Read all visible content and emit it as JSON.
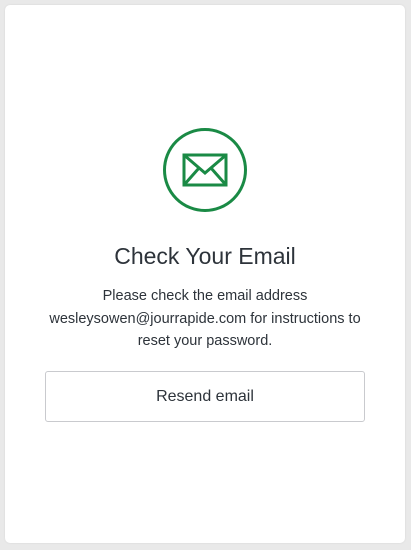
{
  "card": {
    "title": "Check Your Email",
    "message_line1": "Please check the email address",
    "message_line2": "wesleysowen@jourrapide.com for instructions to",
    "message_line3": "reset your password.",
    "resend_label": "Resend email",
    "icon": "envelope-icon"
  },
  "colors": {
    "accent": "#1a8a45",
    "text": "#2d333a",
    "background": "#e9e9e9",
    "card": "#ffffff",
    "button_border": "#c9cace"
  }
}
